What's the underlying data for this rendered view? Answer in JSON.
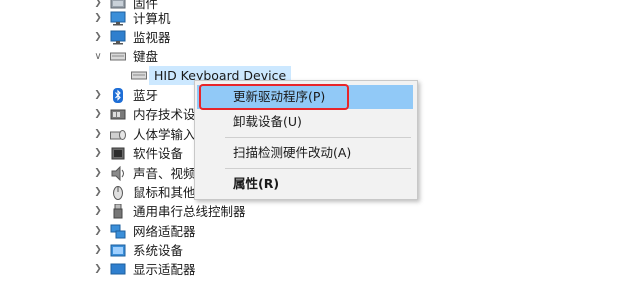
{
  "device_tree": {
    "categories": [
      {
        "label": "固件",
        "icon": "firmware-icon",
        "expanded": false
      },
      {
        "label": "计算机",
        "icon": "computer-icon",
        "expanded": false
      },
      {
        "label": "监视器",
        "icon": "monitor-icon",
        "expanded": false
      },
      {
        "label": "键盘",
        "icon": "keyboard-icon",
        "expanded": true
      },
      {
        "label": "HID Keyboard Device",
        "icon": "keyboard-icon",
        "child": true,
        "selected": true
      },
      {
        "label": "蓝牙",
        "icon": "bluetooth-icon",
        "expanded": false
      },
      {
        "label": "内存技术设",
        "icon": "memory-technology-icon",
        "expanded": false
      },
      {
        "label": "人体学输入",
        "icon": "human-interface-icon",
        "expanded": false
      },
      {
        "label": "软件设备",
        "icon": "software-device-icon",
        "expanded": false
      },
      {
        "label": "声音、视频",
        "icon": "sound-icon",
        "expanded": false
      },
      {
        "label": "鼠标和其他",
        "icon": "mouse-icon",
        "expanded": false
      },
      {
        "label": "通用串行总线控制器",
        "icon": "usb-icon",
        "expanded": false
      },
      {
        "label": "网络适配器",
        "icon": "network-adapter-icon",
        "expanded": false
      },
      {
        "label": "系统设备",
        "icon": "system-device-icon",
        "expanded": false
      },
      {
        "label": "显示适配器",
        "icon": "display-adapter-icon",
        "expanded": false
      }
    ]
  },
  "context_menu": {
    "update_driver": "更新驱动程序(P)",
    "uninstall_device": "卸载设备(U)",
    "scan_hardware": "扫描检测硬件改动(A)",
    "properties": "属性(R)"
  },
  "colors": {
    "highlight": "#cce8ff",
    "menu_hover": "#91c9f7",
    "annotation_red": "#e8252a"
  }
}
